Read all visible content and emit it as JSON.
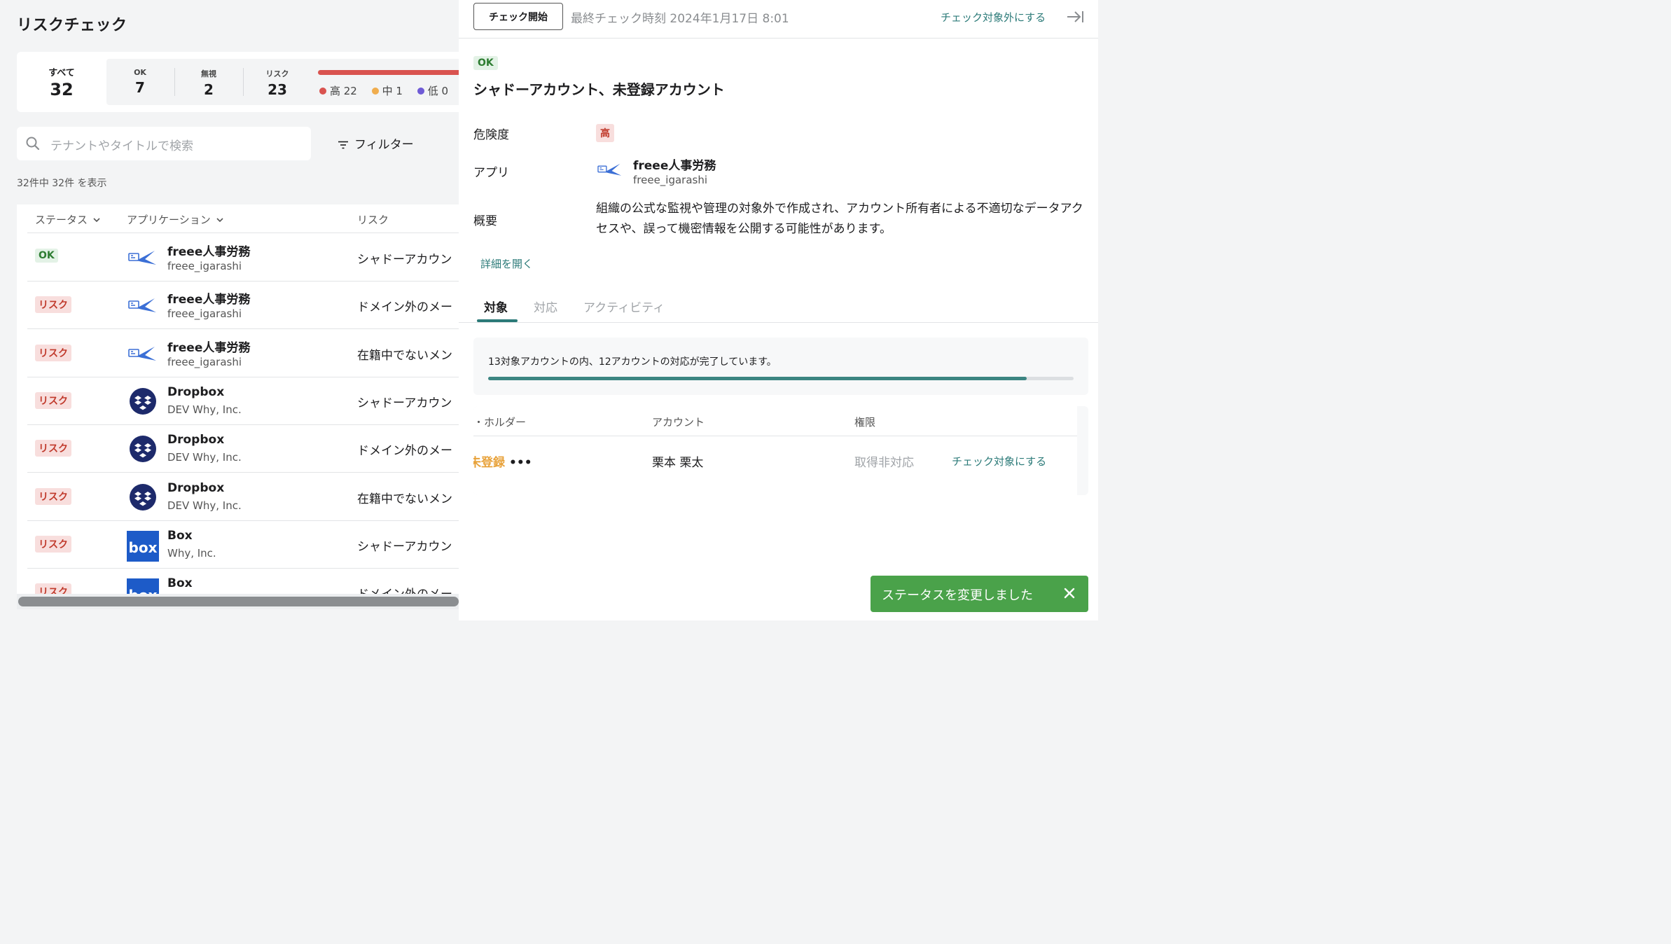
{
  "page": {
    "title": "リスクチェック"
  },
  "summary": {
    "all_label": "すべて",
    "all_value": "32",
    "ok_label": "OK",
    "ok_value": "7",
    "ignore_label": "無視",
    "ignore_value": "2",
    "risk_label": "リスク",
    "risk_value": "23",
    "legend": [
      {
        "label": "高 22",
        "color": "#d9534f"
      },
      {
        "label": "中 1",
        "color": "#f0ad4e"
      },
      {
        "label": "低 0",
        "color": "#6f5bd6"
      }
    ]
  },
  "search": {
    "placeholder": "テナントやタイトルで検索"
  },
  "filter": {
    "label": "フィルター"
  },
  "count_text": "32件中 32件 を表示",
  "table": {
    "headers": {
      "status": "ステータス",
      "application": "アプリケーション",
      "risk": "リスク"
    },
    "rows": [
      {
        "status": "OK",
        "status_type": "ok",
        "icon": "freee-icon",
        "app": "freee人事労務",
        "org": "freee_igarashi",
        "risk": "シャドーアカウン"
      },
      {
        "status": "リスク",
        "status_type": "risk",
        "icon": "freee-icon",
        "app": "freee人事労務",
        "org": "freee_igarashi",
        "risk": "ドメイン外のメー"
      },
      {
        "status": "リスク",
        "status_type": "risk",
        "icon": "freee-icon",
        "app": "freee人事労務",
        "org": "freee_igarashi",
        "risk": "在籍中でないメン"
      },
      {
        "status": "リスク",
        "status_type": "risk",
        "icon": "dropbox-icon",
        "app": "Dropbox",
        "org": "DEV Why, Inc.",
        "risk": "シャドーアカウン"
      },
      {
        "status": "リスク",
        "status_type": "risk",
        "icon": "dropbox-icon",
        "app": "Dropbox",
        "org": "DEV Why, Inc.",
        "risk": "ドメイン外のメー"
      },
      {
        "status": "リスク",
        "status_type": "risk",
        "icon": "dropbox-icon",
        "app": "Dropbox",
        "org": "DEV Why, Inc.",
        "risk": "在籍中でないメン"
      },
      {
        "status": "リスク",
        "status_type": "risk",
        "icon": "box-icon",
        "app": "Box",
        "org": "Why, Inc.",
        "risk": "シャドーアカウン"
      },
      {
        "status": "リスク",
        "status_type": "risk",
        "icon": "box-icon",
        "app": "Box",
        "org": "",
        "risk": "ドメイン外のメー"
      }
    ]
  },
  "detail": {
    "check_button": "チェック開始",
    "last_check": "最終チェック時刻 2024年1月17日 8:01",
    "exclude_link": "チェック対象外にする",
    "status_badge": "OK",
    "title": "シャドーアカウント、未登録アカウント",
    "severity_label": "危険度",
    "severity_value": "高",
    "app_label": "アプリ",
    "app_name": "freee人事労務",
    "app_org": "freee_igarashi",
    "summary_label": "概要",
    "summary_text": "組織の公式な監視や管理の対象外で作成され、アカウント所有者による不適切なデータアクセスや、誤って機密情報を公開する可能性があります。",
    "detail_link": "詳細を開く",
    "tabs": [
      "対象",
      "対応",
      "アクティビティ"
    ],
    "progress_text": "13対象アカウントの内、12アカウントの対応が完了しています。",
    "progress_fraction": 0.92,
    "accounts": {
      "headers": {
        "holder": "・ホルダー",
        "account": "アカウント",
        "permission": "権限"
      },
      "rows": [
        {
          "holder": "未登録",
          "more": "•••",
          "account": "栗本 栗太",
          "permission": "取得非対応",
          "action": "チェック対象にする"
        }
      ]
    }
  },
  "toast": {
    "message": "ステータスを変更しました"
  },
  "colors": {
    "accent": "#2b7a78",
    "risk": "#d9534f",
    "ok": "#2e7d32",
    "toast": "#4aa24a"
  }
}
